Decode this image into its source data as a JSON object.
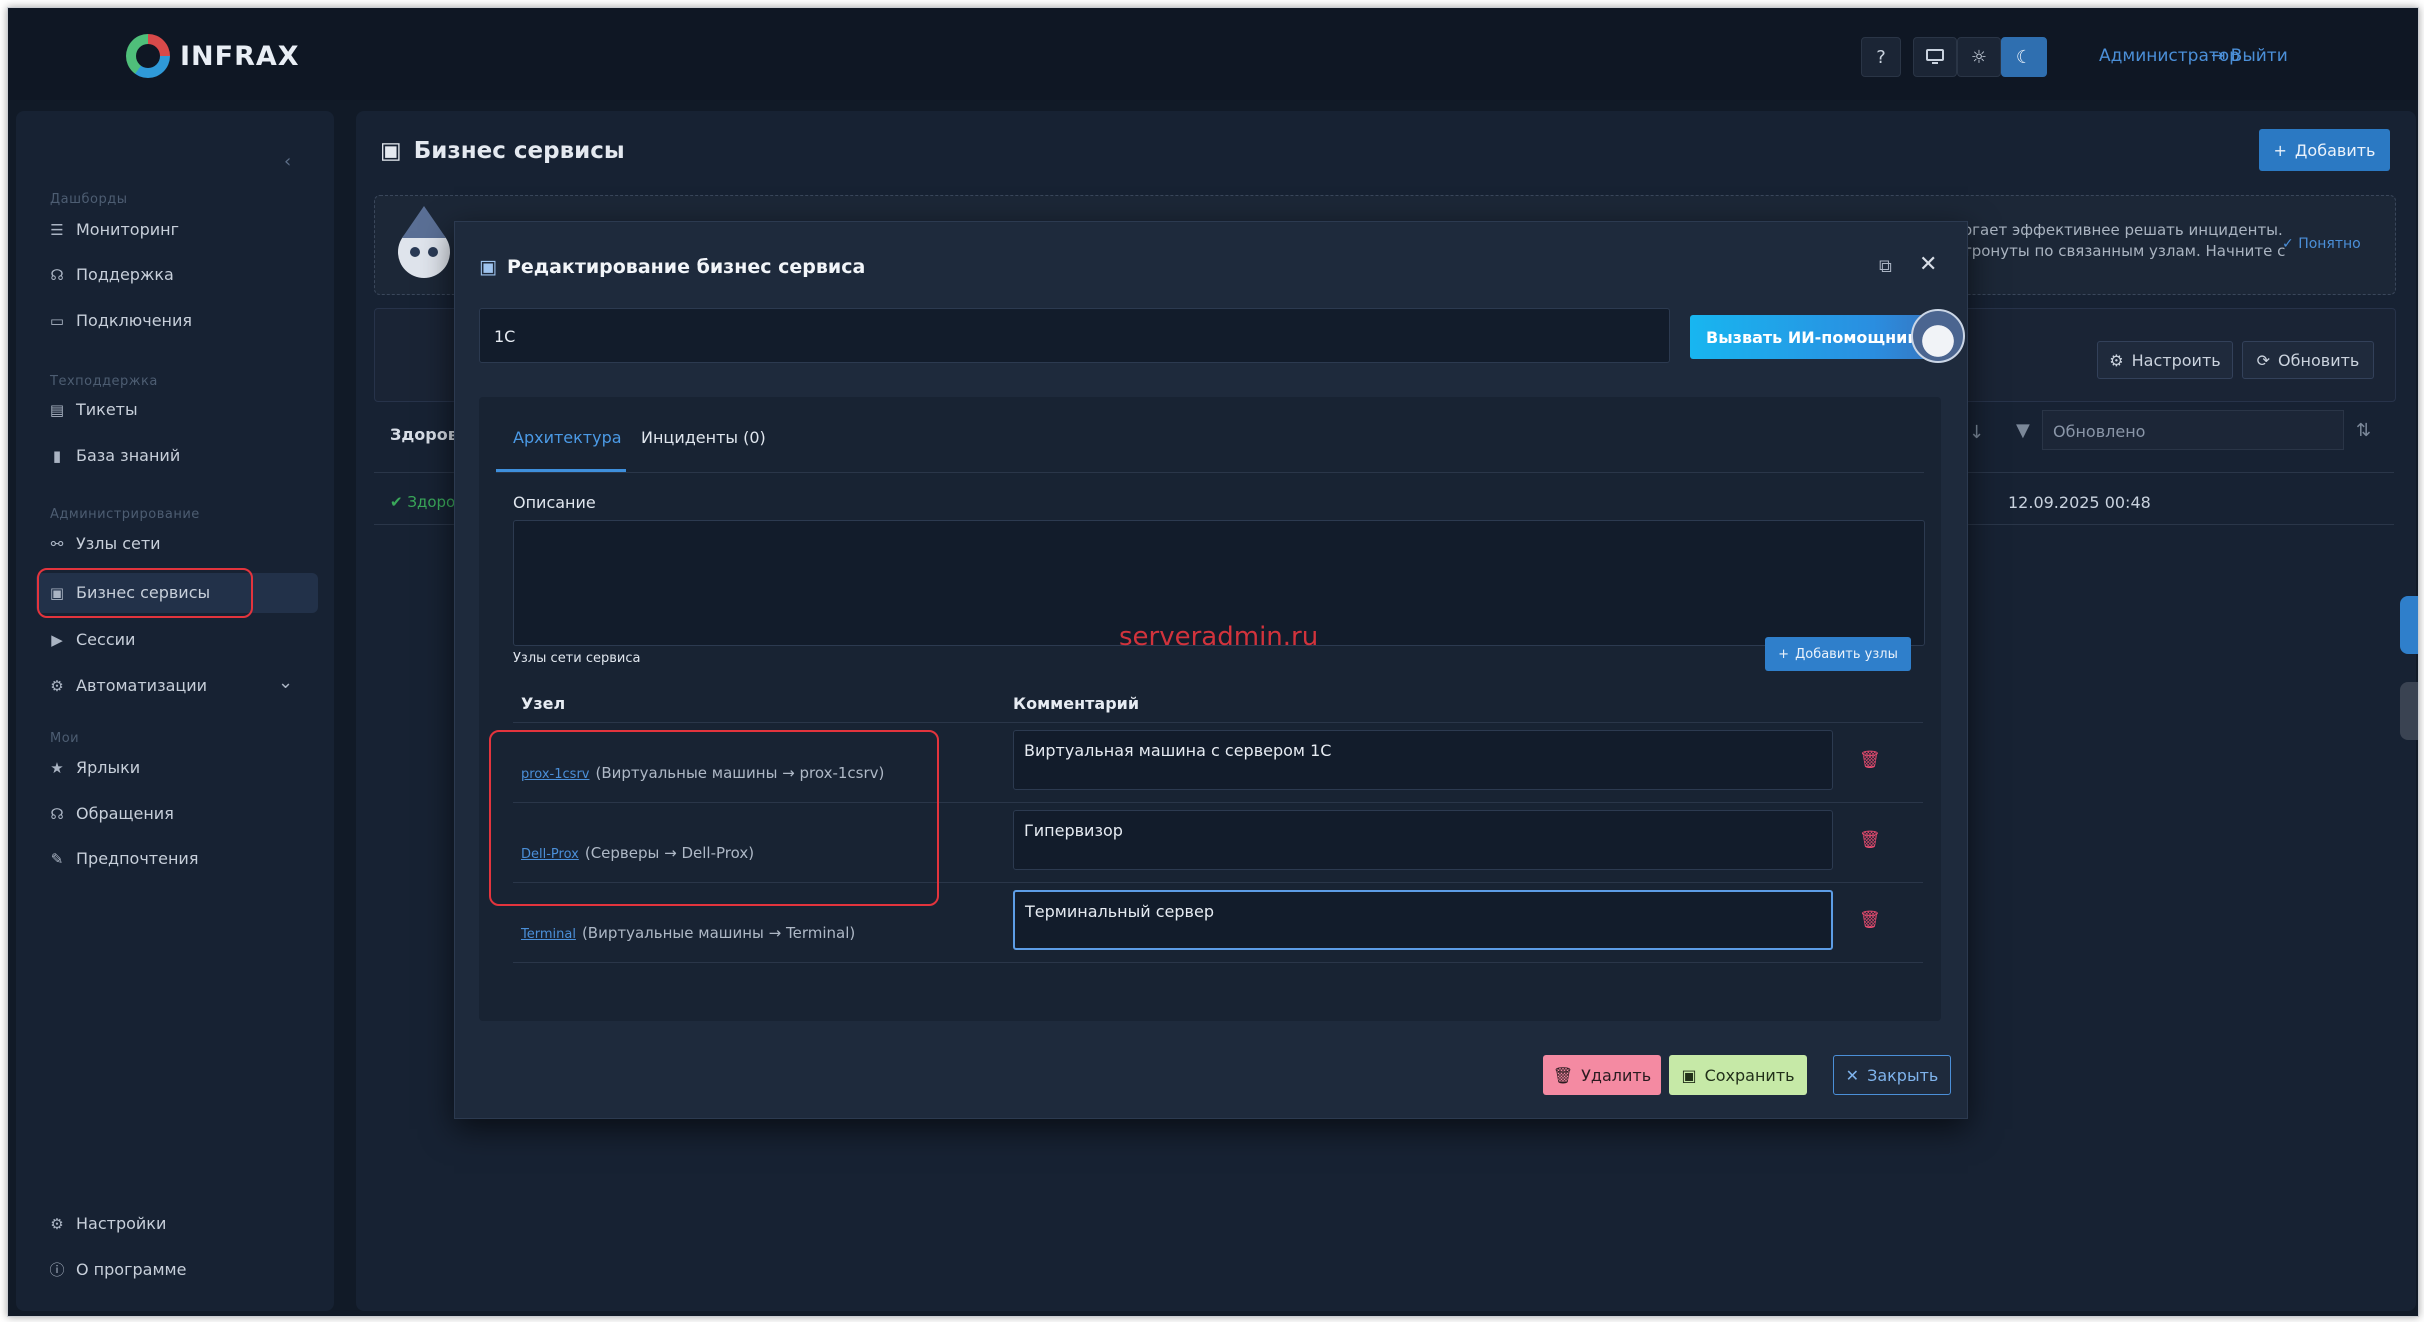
{
  "app": {
    "name": "INFRAX"
  },
  "topbar": {
    "help": "?",
    "user": "Администратор",
    "logout": "Выйти"
  },
  "sidebar": {
    "sections": [
      {
        "title": "Дашборды"
      },
      {
        "title": "Техподдержка"
      },
      {
        "title": "Администрирование"
      },
      {
        "title": "Мои"
      }
    ],
    "items": [
      {
        "label": "Мониторинг",
        "icon": "server-icon"
      },
      {
        "label": "Поддержка",
        "icon": "headset-icon"
      },
      {
        "label": "Подключения",
        "icon": "monitor-icon"
      },
      {
        "label": "Тикеты",
        "icon": "ticket-icon"
      },
      {
        "label": "База знаний",
        "icon": "book-icon"
      },
      {
        "label": "Узлы сети",
        "icon": "sitemap-icon"
      },
      {
        "label": "Бизнес сервисы",
        "icon": "briefcase-icon"
      },
      {
        "label": "Сессии",
        "icon": "video-icon"
      },
      {
        "label": "Автоматизации",
        "icon": "robot-icon"
      },
      {
        "label": "Ярлыки",
        "icon": "star-icon"
      },
      {
        "label": "Обращения",
        "icon": "headset-icon"
      },
      {
        "label": "Предпочтения",
        "icon": "wrench-icon"
      },
      {
        "label": "Настройки",
        "icon": "gears-icon"
      },
      {
        "label": "О программе",
        "icon": "info-icon"
      }
    ]
  },
  "page": {
    "title": "Бизнес сервисы",
    "add_button": "Добавить",
    "banner_line1": "огает эффективнее решать инциденты.",
    "banner_line2": "тронуты по связанным узлам. Начните с",
    "banner_ok": "Понятно",
    "configure_button": "Настроить",
    "refresh_button": "Обновить",
    "col_health_partial": "Здоровь",
    "row_health_partial": "Здоро",
    "col_updated": "Обновлено",
    "row_updated": "12.09.2025 00:48"
  },
  "modal": {
    "title": "Редактирование бизнес сервиса",
    "name_value": "1С",
    "ai_button": "Вызвать ИИ-помощника",
    "tabs": [
      {
        "label": "Архитектура",
        "active": true
      },
      {
        "label": "Инциденты (0)",
        "active": false
      }
    ],
    "description_label": "Описание",
    "description_value": "",
    "nodes_label": "Узлы сети сервиса",
    "add_nodes_button": "Добавить узлы",
    "watermark": "serveradmin.ru",
    "columns": {
      "node": "Узел",
      "comment": "Комментарий"
    },
    "rows": [
      {
        "link": "prox-1csrv",
        "path": "(Виртуальные машины → prox-1csrv)",
        "comment": "Виртуальная машина с сервером 1С"
      },
      {
        "link": "Dell-Prox",
        "path": "(Серверы → Dell-Prox)",
        "comment": "Гипервизор"
      },
      {
        "link": "Terminal",
        "path": "(Виртуальные машины → Terminal)",
        "comment": "Терминальный сервер"
      }
    ],
    "delete_button": "Удалить",
    "save_button": "Сохранить",
    "close_button": "Закрыть"
  },
  "colors": {
    "accent": "#2b79c3",
    "danger": "#f48aa2",
    "success": "#c6e9a7",
    "highlight": "#e3343d"
  }
}
